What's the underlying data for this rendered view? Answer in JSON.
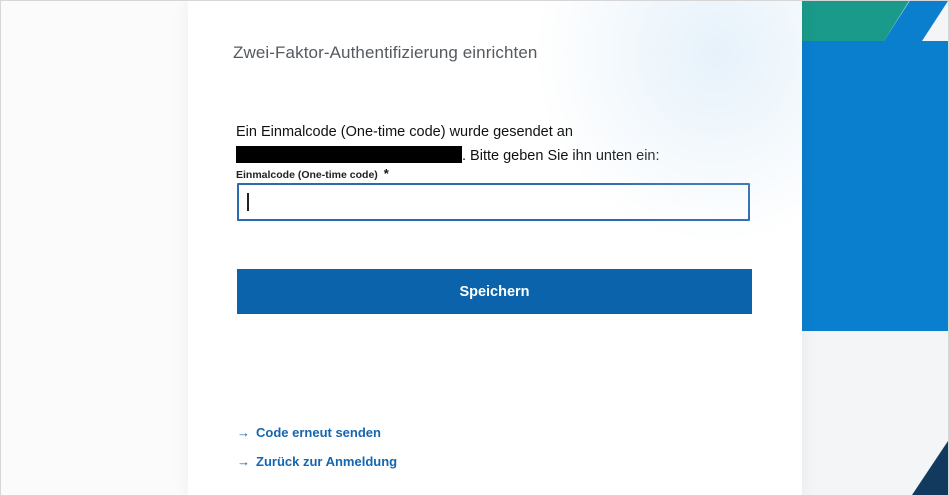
{
  "page": {
    "title": "Zwei-Faktor-Authentifizierung einrichten",
    "message_line1": "Ein Einmalcode (One-time code) wurde gesendet an",
    "message_line2_suffix": ". Bitte geben Sie ihn unten ein:",
    "field_label": "Einmalcode (One-time code)",
    "required_marker": "*",
    "input_value": "",
    "save_button": "Speichern",
    "links": [
      {
        "arrow": "→",
        "label": "Code erneut senden"
      },
      {
        "arrow": "→",
        "label": "Zurück zur Anmeldung"
      }
    ]
  },
  "colors": {
    "primary": "#0a63ab",
    "link": "#1466b0",
    "teal": "#1a9a8a",
    "accent_blue": "#0a7fce",
    "dark_navy": "#123a5e"
  }
}
